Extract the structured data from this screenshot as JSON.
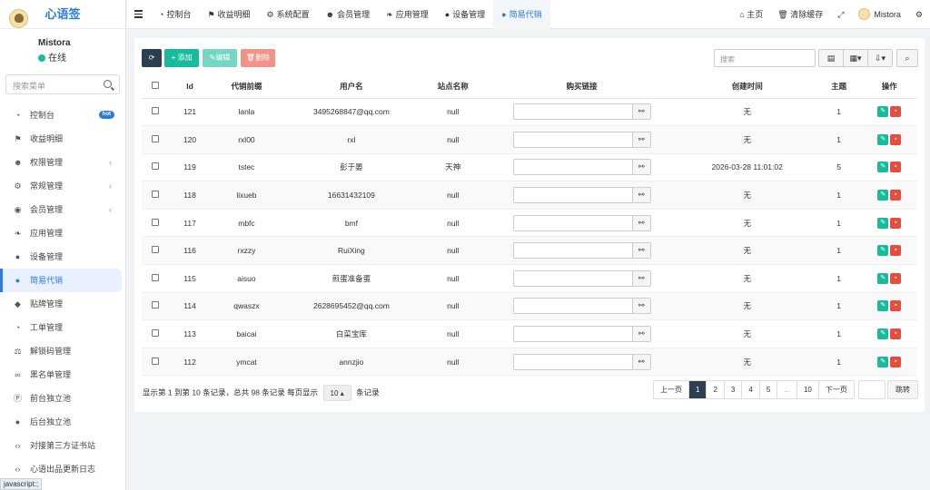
{
  "app": {
    "logo": "心语签"
  },
  "user": {
    "name": "Mistora",
    "status": "在线"
  },
  "sidebar": {
    "search_placeholder": "搜索菜单",
    "items": [
      {
        "label": "控制台",
        "icon": "dashboard-icon",
        "badge": "hot"
      },
      {
        "label": "收益明细",
        "icon": "flag-icon"
      },
      {
        "label": "权限管理",
        "icon": "group-icon",
        "arrow": "‹"
      },
      {
        "label": "常规管理",
        "icon": "cogs-icon",
        "arrow": "‹"
      },
      {
        "label": "会员管理",
        "icon": "user-circle-icon",
        "arrow": "‹"
      },
      {
        "label": "应用管理",
        "icon": "leaf-icon"
      },
      {
        "label": "设备管理",
        "icon": "circle-icon"
      },
      {
        "label": "简易代销",
        "icon": "circle-icon",
        "active": true
      },
      {
        "label": "贴牌管理",
        "icon": "tags-icon"
      },
      {
        "label": "工单管理",
        "icon": "dashboard-icon"
      },
      {
        "label": "解锁码管理",
        "icon": "balance-icon"
      },
      {
        "label": "黑名单管理",
        "icon": "bicycle-icon"
      },
      {
        "label": "前台独立池",
        "icon": "p-circle-icon"
      },
      {
        "label": "后台独立池",
        "icon": "apple-icon"
      },
      {
        "label": "对接第三方证书站",
        "icon": "code-icon"
      },
      {
        "label": "心语出品更新日志",
        "icon": "code-icon"
      }
    ]
  },
  "topnav": {
    "tabs": [
      {
        "label": "控制台",
        "icon": "dashboard-icon"
      },
      {
        "label": "收益明细",
        "icon": "flag-icon"
      },
      {
        "label": "系统配置",
        "icon": "cog-icon"
      },
      {
        "label": "会员管理",
        "icon": "users-icon"
      },
      {
        "label": "应用管理",
        "icon": "leaf-icon"
      },
      {
        "label": "设备管理",
        "icon": "circle-icon"
      },
      {
        "label": "简易代销",
        "icon": "circle-icon",
        "active": true
      }
    ],
    "right": {
      "home": "主页",
      "clear_cache": "清除缓存",
      "user": "Mistora"
    }
  },
  "toolbar": {
    "add": "添加",
    "edit": "编辑",
    "delete": "删除",
    "search_placeholder": "搜索"
  },
  "table": {
    "columns": [
      "Id",
      "代销前缀",
      "用户名",
      "站点名称",
      "购买链接",
      "创建时间",
      "主题",
      "操作"
    ],
    "rows": [
      {
        "id": "121",
        "prefix": "lanla",
        "username": "3495268847@qq.com",
        "site": "null",
        "created": "无",
        "theme": "1"
      },
      {
        "id": "120",
        "prefix": "rxl00",
        "username": "rxl",
        "site": "null",
        "created": "无",
        "theme": "1"
      },
      {
        "id": "119",
        "prefix": "tstec",
        "username": "彭于晏",
        "site": "天神",
        "created": "2026-03-28 11:01:02",
        "theme": "5"
      },
      {
        "id": "118",
        "prefix": "lixueb",
        "username": "16631432109",
        "site": "null",
        "created": "无",
        "theme": "1"
      },
      {
        "id": "117",
        "prefix": "mbfc",
        "username": "bmf",
        "site": "null",
        "created": "无",
        "theme": "1"
      },
      {
        "id": "116",
        "prefix": "rxzzy",
        "username": "RuiXing",
        "site": "null",
        "created": "无",
        "theme": "1"
      },
      {
        "id": "115",
        "prefix": "aisuo",
        "username": "煎蛋准备蛋",
        "site": "null",
        "created": "无",
        "theme": "1"
      },
      {
        "id": "114",
        "prefix": "qwaszx",
        "username": "2628695452@qq.com",
        "site": "null",
        "created": "无",
        "theme": "1"
      },
      {
        "id": "113",
        "prefix": "baicai",
        "username": "白菜宝库",
        "site": "null",
        "created": "无",
        "theme": "1"
      },
      {
        "id": "112",
        "prefix": "ymcat",
        "username": "annzjio",
        "site": "null",
        "created": "无",
        "theme": "1"
      }
    ]
  },
  "pagination": {
    "info_prefix": "显示第 1 到第 10 条记录，总共 98 条记录 每页显示",
    "page_size": "10",
    "info_suffix": "条记录",
    "prev": "上一页",
    "pages": [
      "1",
      "2",
      "3",
      "4",
      "5",
      "...",
      "10"
    ],
    "current": "1",
    "next": "下一页",
    "jump": "跳转"
  },
  "statusbar": {
    "text": "javascript:;"
  },
  "colors": {
    "accent": "#2c7be5",
    "success": "#18bc9c",
    "danger": "#e74c3c",
    "dark": "#2c3e50"
  }
}
